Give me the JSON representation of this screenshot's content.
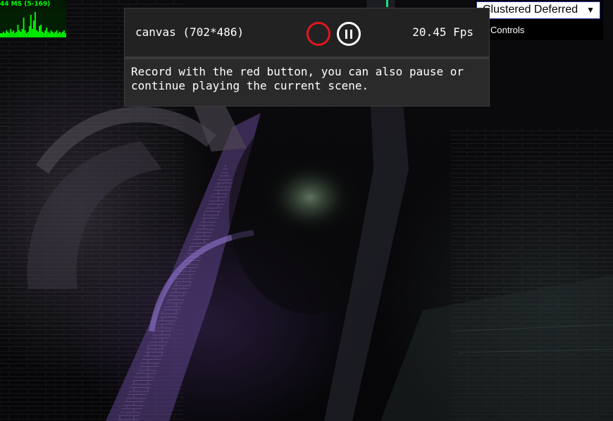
{
  "stats": {
    "label": "44 MS (5-169)",
    "color": "#00ff00",
    "graph_samples": [
      3,
      3,
      4,
      3,
      5,
      4,
      3,
      6,
      4,
      5,
      3,
      4,
      9,
      5,
      4,
      6,
      14,
      5,
      3,
      4,
      8,
      16,
      6,
      12,
      18,
      5,
      4,
      8,
      9,
      4,
      3,
      5,
      7,
      4,
      3,
      5,
      4,
      3,
      4,
      5,
      3,
      4,
      3,
      4,
      5,
      3
    ]
  },
  "gui": {
    "renderer": "Clustered Deferred",
    "controls_label": "Controls"
  },
  "recorder": {
    "canvas_label": "canvas (702*486)",
    "fps": "20.45 Fps",
    "message": "Record with the red button, you can also pause or\ncontinue playing the current scene.",
    "record_color": "#e3151d"
  }
}
